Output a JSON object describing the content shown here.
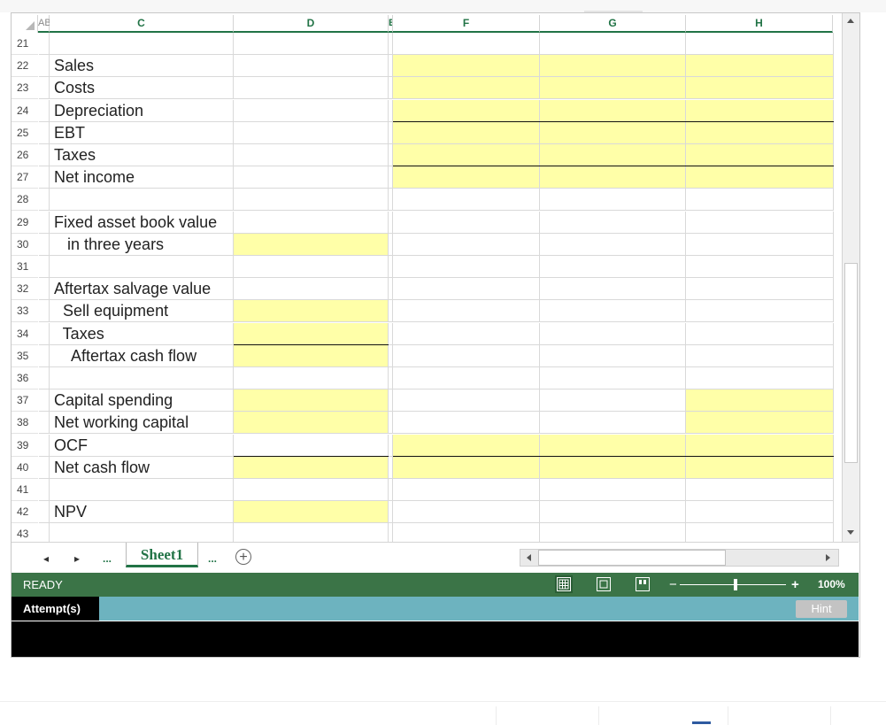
{
  "columns": [
    "AB",
    "C",
    "D",
    "E",
    "F",
    "G",
    "H"
  ],
  "rows": [
    {
      "num": "21",
      "label": ""
    },
    {
      "num": "22",
      "label": "Sales"
    },
    {
      "num": "23",
      "label": "Costs"
    },
    {
      "num": "24",
      "label": "Depreciation"
    },
    {
      "num": "25",
      "label": "EBT"
    },
    {
      "num": "26",
      "label": "Taxes"
    },
    {
      "num": "27",
      "label": "Net income"
    },
    {
      "num": "28",
      "label": ""
    },
    {
      "num": "29",
      "label": "Fixed asset book value"
    },
    {
      "num": "30",
      "label": "   in three years"
    },
    {
      "num": "31",
      "label": ""
    },
    {
      "num": "32",
      "label": "Aftertax salvage value"
    },
    {
      "num": "33",
      "label": "  Sell equipment"
    },
    {
      "num": "34",
      "label": "  Taxes"
    },
    {
      "num": "35",
      "label": "    Aftertax cash flow"
    },
    {
      "num": "36",
      "label": ""
    },
    {
      "num": "37",
      "label": "Capital spending"
    },
    {
      "num": "38",
      "label": "Net working capital"
    },
    {
      "num": "39",
      "label": "OCF"
    },
    {
      "num": "40",
      "label": "Net cash flow"
    },
    {
      "num": "41",
      "label": ""
    },
    {
      "num": "42",
      "label": "NPV"
    },
    {
      "num": "43",
      "label": ""
    }
  ],
  "tabs": {
    "prev": "◂",
    "next": "▸",
    "ellipsis_left": "...",
    "sheet": "Sheet1",
    "ellipsis_right": "...",
    "add": "+"
  },
  "status": {
    "ready": "READY",
    "zoom_minus": "−",
    "zoom_plus": "+",
    "zoom": "100%"
  },
  "attempt": {
    "label": "Attempt(s)",
    "hint": "Hint"
  },
  "colors": {
    "input_fill": "#ffffa8",
    "status_bar": "#3b7447",
    "header_accent": "#217346",
    "attempt_bar": "#6db3bf"
  }
}
